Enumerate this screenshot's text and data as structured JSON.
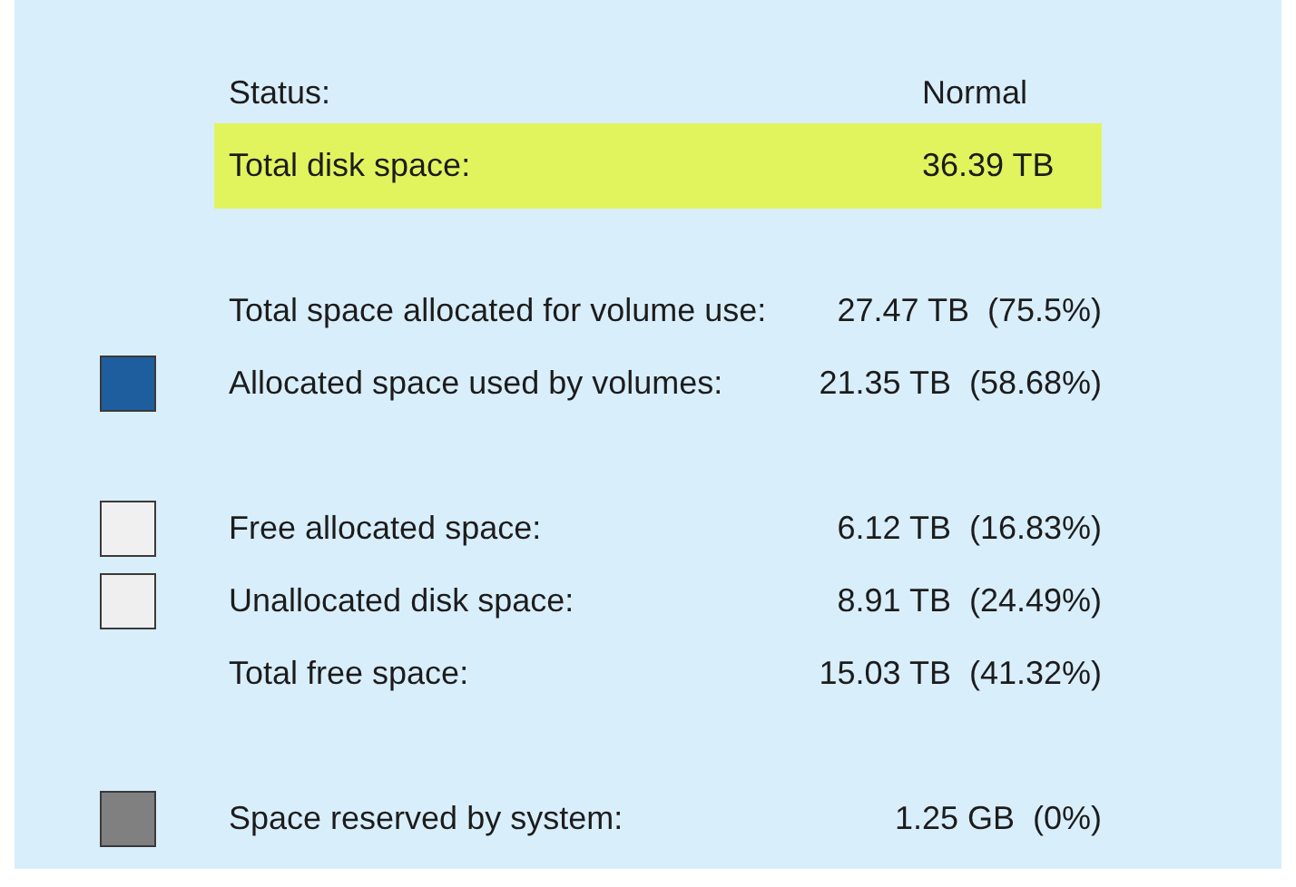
{
  "groups": [
    {
      "rows": [
        {
          "label": "Status:",
          "value": "Normal",
          "highlighted": false
        },
        {
          "label": "Total disk space:",
          "value": "36.39 TB",
          "highlighted": true
        }
      ]
    },
    {
      "rows": [
        {
          "label": "Total space allocated for volume use:",
          "value": "27.47 TB  (75.5%)",
          "highlighted": false
        },
        {
          "label": "Allocated space used by volumes:",
          "value": "21.35 TB  (58.68%)",
          "highlighted": false,
          "color": "#1f5e9e"
        }
      ]
    },
    {
      "rows": [
        {
          "label": "Free allocated space:",
          "value": "6.12 TB  (16.83%)",
          "highlighted": false,
          "color": "#f0f0f0"
        },
        {
          "label": "Unallocated disk space:",
          "value": "8.91 TB  (24.49%)",
          "highlighted": false,
          "color": "#efefef"
        },
        {
          "label": "Total free space:",
          "value": "15.03 TB  (41.32%)",
          "highlighted": false
        }
      ]
    },
    {
      "rows": [
        {
          "label": "Space reserved by system:",
          "value": "1.25 GB  (0%)",
          "highlighted": false,
          "color": "#808080"
        }
      ]
    }
  ]
}
